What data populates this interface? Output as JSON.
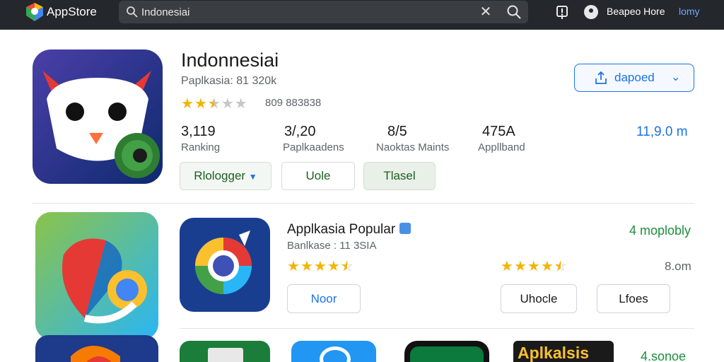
{
  "header": {
    "brand": "AppStore",
    "search_value": "Indonesiai",
    "clear_symbol": "✕",
    "user_text": "Beapeo Hore",
    "link_text": "lomy"
  },
  "featured": {
    "title": "Indonnesiai",
    "subtitle": "Paplkasia: 81 320k",
    "rating_value": 2.5,
    "rating_text": "809 883838",
    "stats": [
      {
        "value": "3,119",
        "label": "Ranking"
      },
      {
        "value": "3/,20",
        "label": "Paplkaadens"
      },
      {
        "value": "8/5",
        "label": "Naoktas Maints"
      },
      {
        "value": "475A",
        "label": "Appllband"
      }
    ],
    "size": "11,9.0 m",
    "action_button": "dapoed",
    "chips": [
      "Rlologger",
      "Uole",
      "Tlasel"
    ]
  },
  "popular": {
    "title": "Applkasia Popular",
    "subtitle": "Banlkase : 11 3SIA",
    "rating_value": 4.5,
    "right_rating_value": 4.5,
    "right_status": "4 moplobly",
    "right_size": "8.om",
    "buttons": [
      "Noor",
      "Uhocle",
      "Lfoes"
    ]
  },
  "bottom": {
    "tile_label": "Aplkalsis",
    "status": "4.sonoe"
  },
  "colors": {
    "accent": "#1a73e8",
    "green": "#1e8e3e",
    "star": "#f4b400",
    "topbar": "#24272b"
  },
  "icons": [
    "search-icon",
    "clear-icon",
    "alert-icon",
    "profile-icon",
    "share-icon",
    "chevron-down-icon"
  ]
}
